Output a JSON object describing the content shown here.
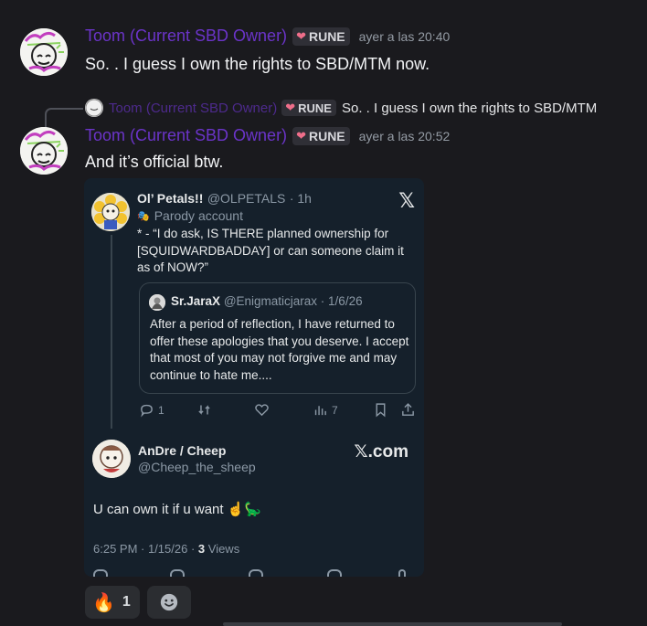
{
  "messages": [
    {
      "author": "Toom (Current SBD Owner)",
      "tag": "RUNE",
      "timestamp": "ayer a las 20:40",
      "text": "So. . I guess I own the rights to SBD/MTM now."
    },
    {
      "reply": {
        "author": "Toom (Current SBD Owner)",
        "tag": "RUNE",
        "text": "So. . I guess I own the rights to SBD/MTM"
      },
      "author": "Toom (Current SBD Owner)",
      "tag": "RUNE",
      "timestamp": "ayer a las 20:52",
      "text": "And it’s official btw."
    }
  ],
  "embed": {
    "tweet": {
      "name": "Ol’ Petals!!",
      "handle": "@OLPETALS",
      "time": "· 1h",
      "label": "Parody account",
      "body": "* - “I do ask, IS THERE planned ownership for [SQUIDWARDBADDAY] or can someone claim it as of NOW?”"
    },
    "quote": {
      "name": "Sr.JaraX",
      "handle": "@Enigmaticjarax · 1/6/26",
      "body": "After a period of reflection, I have returned to offer these apologies that you deserve. I accept that most of you may not forgive me and may continue to hate me...."
    },
    "stats": {
      "replies": "1",
      "views": "7"
    },
    "reply_tweet": {
      "name": "AnDre / Cheep",
      "handle": "@Cheep_the_sheep",
      "body": "U can own it if u want ☝️🦕",
      "date": "6:25 PM · 1/15/26 · ",
      "views_count": "3",
      "views_label": " Views"
    },
    "x_logo": "𝕏",
    "site": "𝕏.com"
  },
  "reactions": [
    {
      "emoji": "🔥",
      "count": "1"
    }
  ],
  "colors": {
    "background": "#1a1a1e",
    "username": "#6b34c9",
    "embed_bg": "#15202b",
    "tag_heart": "#ee6e8a"
  }
}
